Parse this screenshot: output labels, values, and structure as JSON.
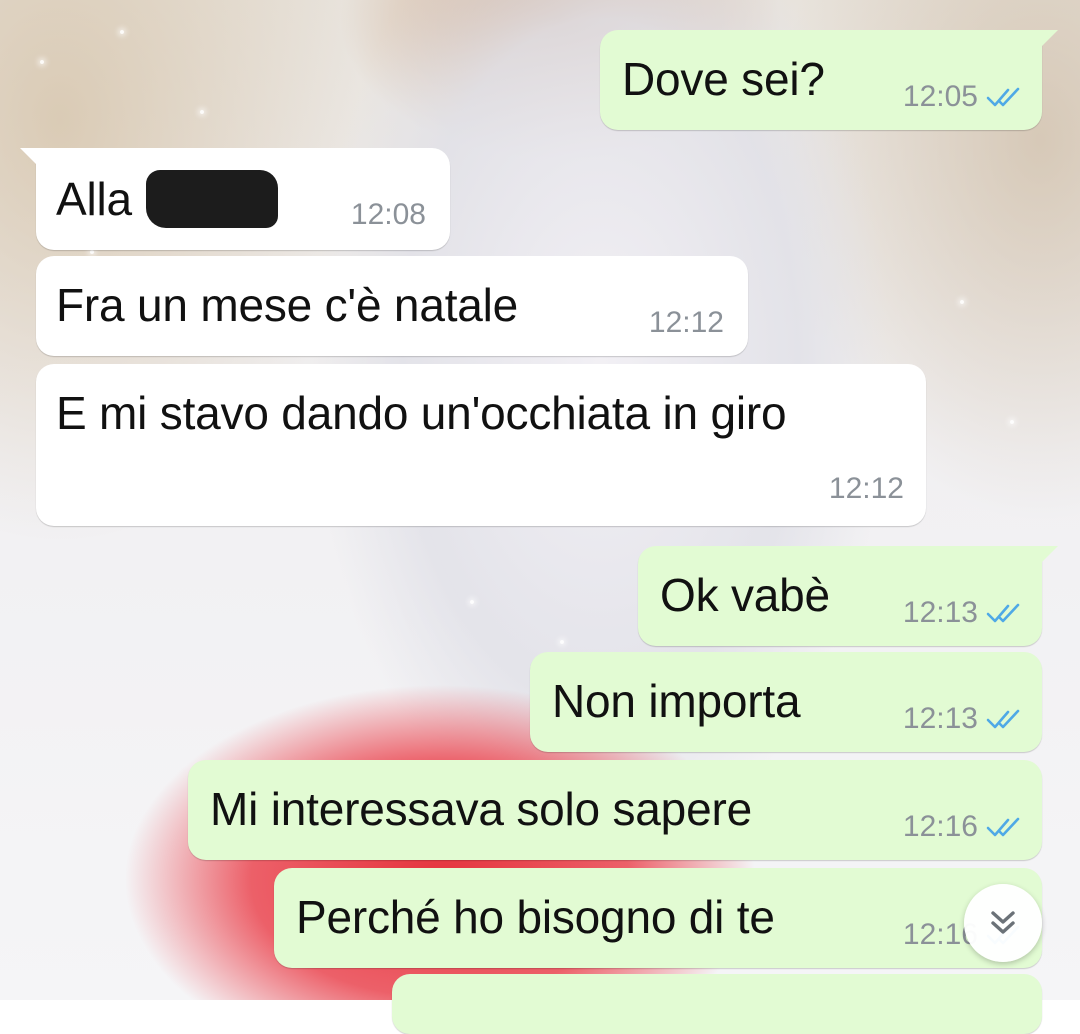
{
  "chat": {
    "messages": [
      {
        "direction": "outgoing",
        "text": "Dove sei?",
        "time": "12:05",
        "status": "read"
      },
      {
        "direction": "incoming",
        "text": "Alla",
        "redacted": true,
        "time": "12:08"
      },
      {
        "direction": "incoming",
        "text": "Fra un mese c'è natale",
        "time": "12:12"
      },
      {
        "direction": "incoming",
        "text": "E mi stavo dando un'occhiata in giro",
        "time": "12:12"
      },
      {
        "direction": "outgoing",
        "text": "Ok vabè",
        "time": "12:13",
        "status": "read"
      },
      {
        "direction": "outgoing",
        "text": "Non importa",
        "time": "12:13",
        "status": "read"
      },
      {
        "direction": "outgoing",
        "text": "Mi interessava solo sapere",
        "time": "12:16",
        "status": "read"
      },
      {
        "direction": "outgoing",
        "text": "Perché ho bisogno di te",
        "time": "12:16",
        "status": "read"
      }
    ]
  },
  "icons": {
    "read_ticks": "double-check-icon",
    "scroll_down": "chevron-double-down-icon"
  },
  "colors": {
    "outgoing_bubble": "#e2fbd3",
    "incoming_bubble": "#ffffff",
    "read_tick": "#4fa9e6",
    "timestamp": "#8b9198"
  }
}
